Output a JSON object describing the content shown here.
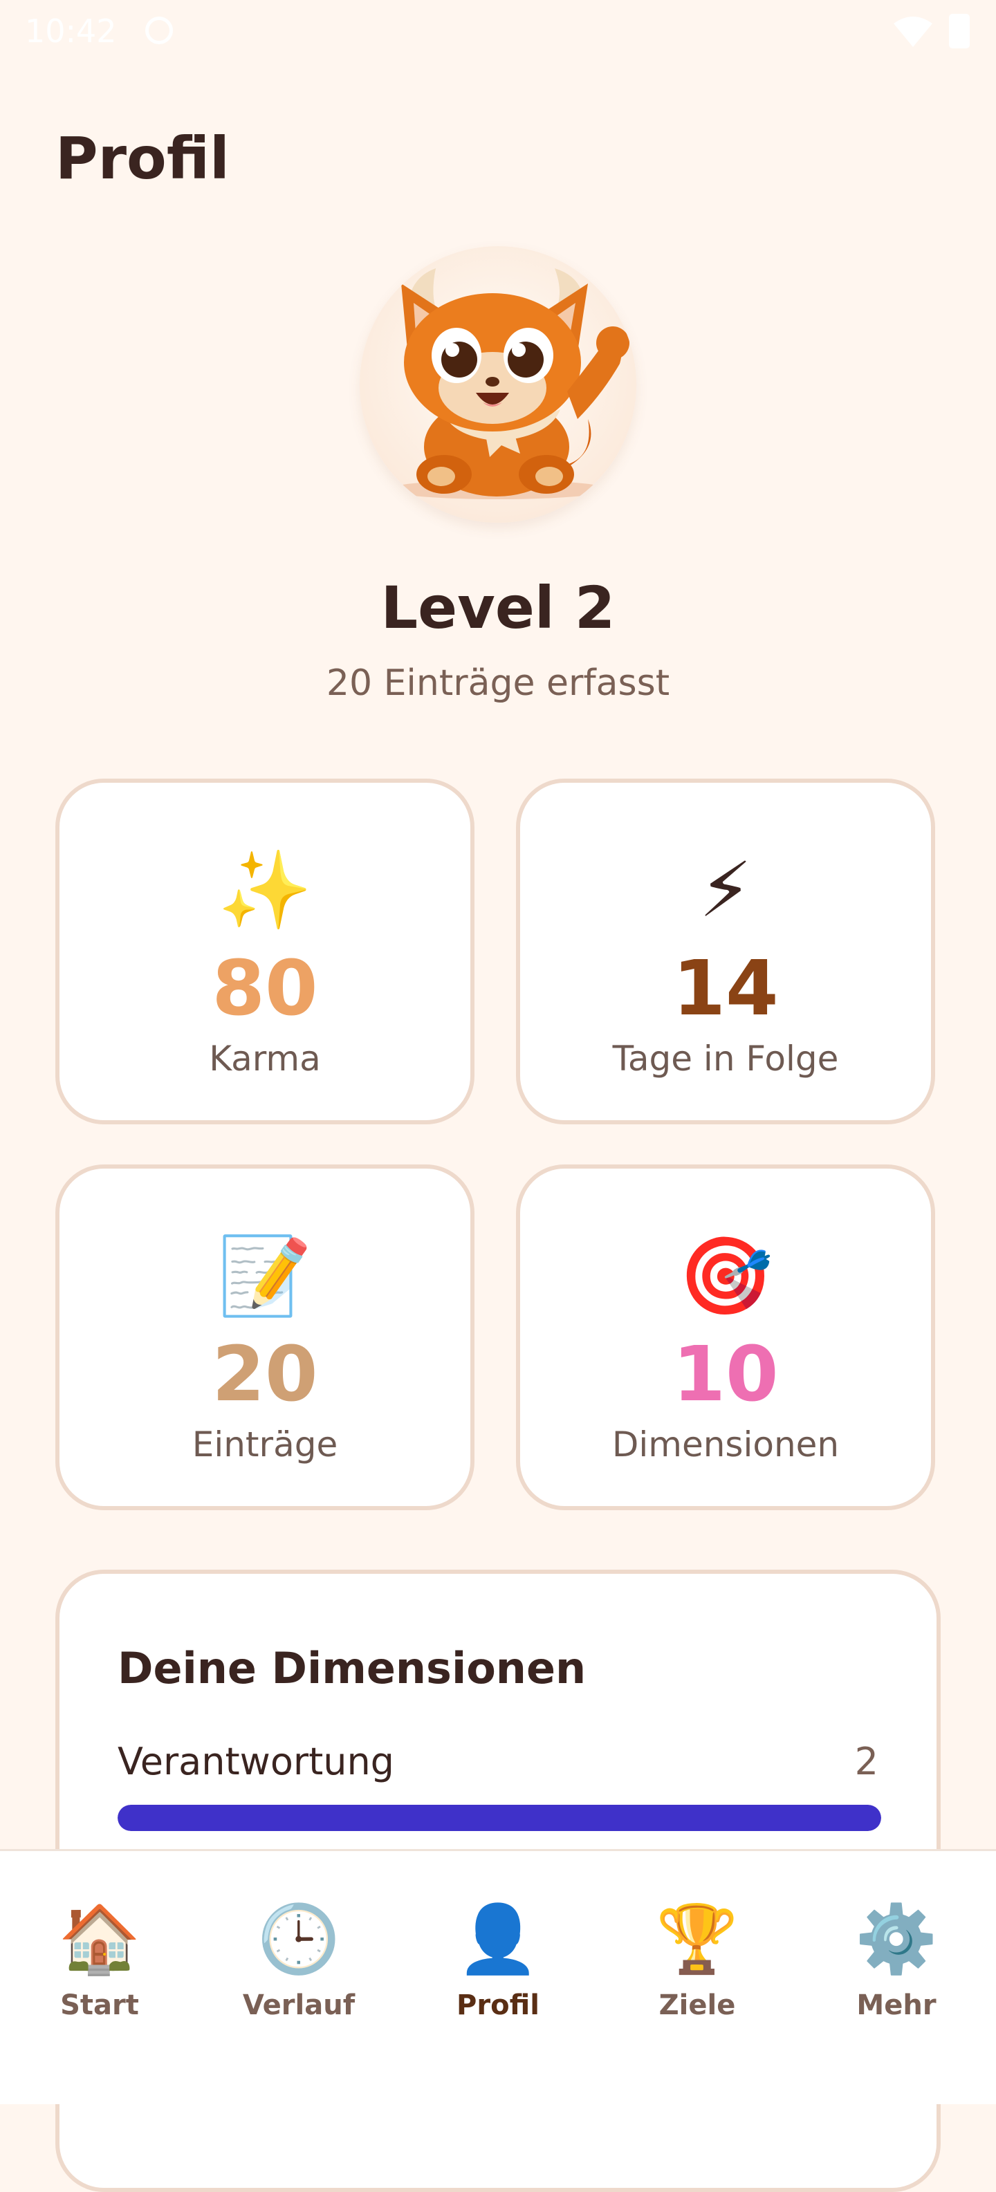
{
  "status_bar": {
    "time": "10:42"
  },
  "header": {
    "title": "Profil"
  },
  "profile": {
    "level": "Level 2",
    "entries_text": "20 Einträge erfasst"
  },
  "stats": [
    {
      "emoji": "✨",
      "value": "80",
      "label": "Karma",
      "color": "#EDA264"
    },
    {
      "emoji": "⚡",
      "value": "14",
      "label": "Tage in Folge",
      "color": "#8A4315"
    },
    {
      "emoji": "📝",
      "value": "20",
      "label": "Einträge",
      "color": "#CFA074"
    },
    {
      "emoji": "🎯",
      "value": "10",
      "label": "Dimensionen",
      "color": "#EE6FB2"
    }
  ],
  "dimensions": {
    "title": "Deine Dimensionen",
    "items": [
      {
        "label": "Verantwortung",
        "value": "2",
        "fill_fraction": 1.0,
        "color": "#3F31C9"
      }
    ]
  },
  "bottom_nav": {
    "items": [
      {
        "icon": "house-icon",
        "emoji": "🏠",
        "label": "Start"
      },
      {
        "icon": "clock-icon",
        "emoji": "🕒",
        "label": "Verlauf"
      },
      {
        "icon": "person-icon",
        "emoji": "👤",
        "label": "Profil",
        "active": true
      },
      {
        "icon": "trophy-icon",
        "emoji": "🏆",
        "label": "Ziele"
      },
      {
        "icon": "gear-icon",
        "emoji": "⚙️",
        "label": "Mehr"
      }
    ]
  }
}
